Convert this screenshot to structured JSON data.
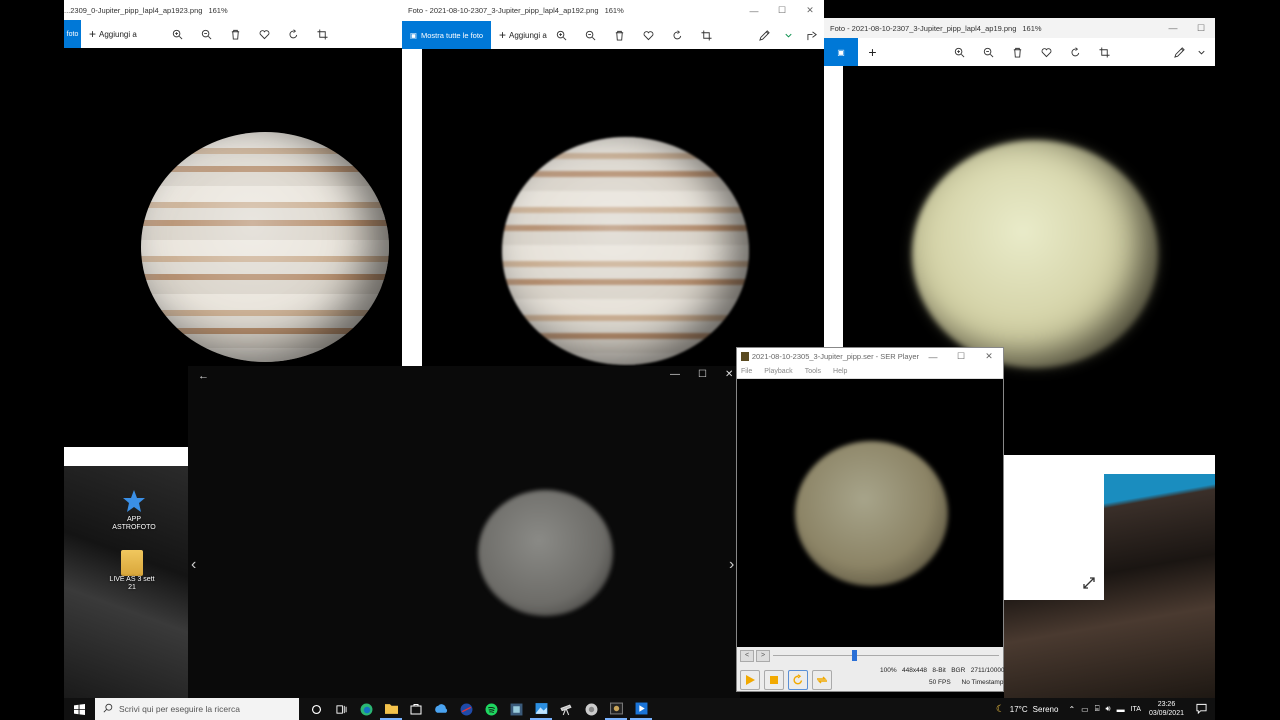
{
  "photos_window_1": {
    "title": "...2309_0-Jupiter_pipp_lapl4_ap1923.png",
    "zoom": "161%",
    "accent_label": "foto",
    "add_label": "Aggiungi a"
  },
  "photos_window_2": {
    "title": "Foto - 2021-08-10-2307_3-Jupiter_pipp_lapl4_ap192.png",
    "zoom": "161%",
    "show_all_label": "Mostra tutte le foto",
    "add_label": "Aggiungi a"
  },
  "photos_window_3": {
    "title": "Foto - 2021-08-10-2307_3-Jupiter_pipp_lapl4_ap19.png",
    "zoom": "161%"
  },
  "ser_player": {
    "title": "2021-08-10-2305_3-Jupiter_pipp.ser - SER Player",
    "menu": [
      "File",
      "Playback",
      "Tools",
      "Help"
    ],
    "status": {
      "zoom": "100%",
      "resolution": "448x448",
      "bit_depth": "8-Bit",
      "color": "BGR",
      "frame": "2711/10000",
      "fps": "50 FPS",
      "timestamp": "No Timestamp"
    },
    "progress": 0.36
  },
  "desktop_icons": [
    {
      "label_line1": "APP",
      "label_line2": "ASTROFOTO"
    },
    {
      "label_line1": "LIVE AS 3 sett",
      "label_line2": "21"
    }
  ],
  "taskbar": {
    "search_placeholder": "Scrivi qui per eseguire la ricerca",
    "weather_temp": "17°C",
    "weather_text": "Sereno",
    "language": "ITA",
    "time": "23:26",
    "date": "03/09/2021"
  },
  "colors": {
    "accent": "#0078d7",
    "taskbar": "#101010"
  }
}
